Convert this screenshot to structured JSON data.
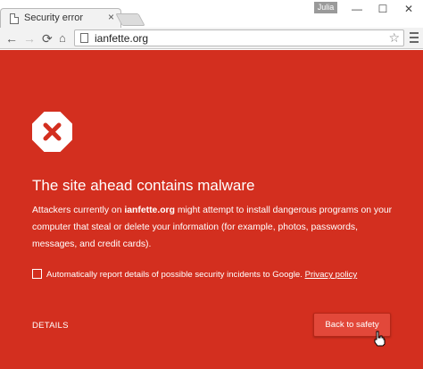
{
  "browser": {
    "tab": {
      "title": "Security error",
      "close_glyph": "×",
      "icon": "page-icon"
    },
    "profile_name": "Julia",
    "window_controls": {
      "minimize": "—",
      "maximize": "☐",
      "close": "✕"
    },
    "toolbar": {
      "back_glyph": "←",
      "forward_glyph": "→",
      "reload_glyph": "⟳",
      "home_glyph": "⌂",
      "url": "ianfette.org",
      "star_glyph": "☆"
    }
  },
  "interstitial": {
    "background_color": "#d32f1f",
    "icon": "alert-x-icon",
    "heading": "The site ahead contains malware",
    "paragraph_prefix": "Attackers currently on ",
    "paragraph_site": "ianfette.org",
    "paragraph_suffix": " might attempt to install dangerous programs on your computer that steal or delete your information (for example, photos, passwords, messages, and credit cards).",
    "report_checkbox_checked": false,
    "report_label": "Automatically report details of possible security incidents to Google.",
    "privacy_link": "Privacy policy",
    "details_label": "DETAILS",
    "back_button_label": "Back to safety"
  }
}
